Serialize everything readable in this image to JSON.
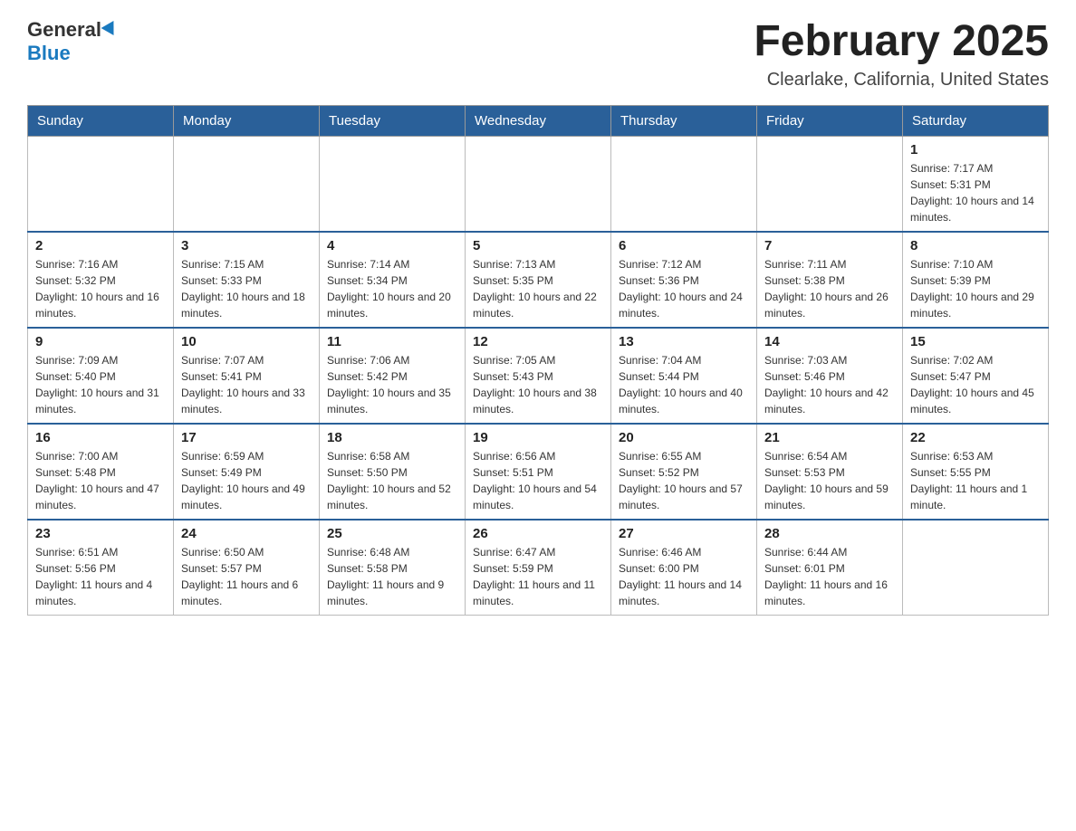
{
  "header": {
    "logo_general": "General",
    "logo_blue": "Blue",
    "title": "February 2025",
    "subtitle": "Clearlake, California, United States"
  },
  "days_of_week": [
    "Sunday",
    "Monday",
    "Tuesday",
    "Wednesday",
    "Thursday",
    "Friday",
    "Saturday"
  ],
  "weeks": [
    {
      "days": [
        {
          "number": "",
          "info": "",
          "empty": true
        },
        {
          "number": "",
          "info": "",
          "empty": true
        },
        {
          "number": "",
          "info": "",
          "empty": true
        },
        {
          "number": "",
          "info": "",
          "empty": true
        },
        {
          "number": "",
          "info": "",
          "empty": true
        },
        {
          "number": "",
          "info": "",
          "empty": true
        },
        {
          "number": "1",
          "info": "Sunrise: 7:17 AM\nSunset: 5:31 PM\nDaylight: 10 hours and 14 minutes.",
          "empty": false
        }
      ]
    },
    {
      "days": [
        {
          "number": "2",
          "info": "Sunrise: 7:16 AM\nSunset: 5:32 PM\nDaylight: 10 hours and 16 minutes.",
          "empty": false
        },
        {
          "number": "3",
          "info": "Sunrise: 7:15 AM\nSunset: 5:33 PM\nDaylight: 10 hours and 18 minutes.",
          "empty": false
        },
        {
          "number": "4",
          "info": "Sunrise: 7:14 AM\nSunset: 5:34 PM\nDaylight: 10 hours and 20 minutes.",
          "empty": false
        },
        {
          "number": "5",
          "info": "Sunrise: 7:13 AM\nSunset: 5:35 PM\nDaylight: 10 hours and 22 minutes.",
          "empty": false
        },
        {
          "number": "6",
          "info": "Sunrise: 7:12 AM\nSunset: 5:36 PM\nDaylight: 10 hours and 24 minutes.",
          "empty": false
        },
        {
          "number": "7",
          "info": "Sunrise: 7:11 AM\nSunset: 5:38 PM\nDaylight: 10 hours and 26 minutes.",
          "empty": false
        },
        {
          "number": "8",
          "info": "Sunrise: 7:10 AM\nSunset: 5:39 PM\nDaylight: 10 hours and 29 minutes.",
          "empty": false
        }
      ]
    },
    {
      "days": [
        {
          "number": "9",
          "info": "Sunrise: 7:09 AM\nSunset: 5:40 PM\nDaylight: 10 hours and 31 minutes.",
          "empty": false
        },
        {
          "number": "10",
          "info": "Sunrise: 7:07 AM\nSunset: 5:41 PM\nDaylight: 10 hours and 33 minutes.",
          "empty": false
        },
        {
          "number": "11",
          "info": "Sunrise: 7:06 AM\nSunset: 5:42 PM\nDaylight: 10 hours and 35 minutes.",
          "empty": false
        },
        {
          "number": "12",
          "info": "Sunrise: 7:05 AM\nSunset: 5:43 PM\nDaylight: 10 hours and 38 minutes.",
          "empty": false
        },
        {
          "number": "13",
          "info": "Sunrise: 7:04 AM\nSunset: 5:44 PM\nDaylight: 10 hours and 40 minutes.",
          "empty": false
        },
        {
          "number": "14",
          "info": "Sunrise: 7:03 AM\nSunset: 5:46 PM\nDaylight: 10 hours and 42 minutes.",
          "empty": false
        },
        {
          "number": "15",
          "info": "Sunrise: 7:02 AM\nSunset: 5:47 PM\nDaylight: 10 hours and 45 minutes.",
          "empty": false
        }
      ]
    },
    {
      "days": [
        {
          "number": "16",
          "info": "Sunrise: 7:00 AM\nSunset: 5:48 PM\nDaylight: 10 hours and 47 minutes.",
          "empty": false
        },
        {
          "number": "17",
          "info": "Sunrise: 6:59 AM\nSunset: 5:49 PM\nDaylight: 10 hours and 49 minutes.",
          "empty": false
        },
        {
          "number": "18",
          "info": "Sunrise: 6:58 AM\nSunset: 5:50 PM\nDaylight: 10 hours and 52 minutes.",
          "empty": false
        },
        {
          "number": "19",
          "info": "Sunrise: 6:56 AM\nSunset: 5:51 PM\nDaylight: 10 hours and 54 minutes.",
          "empty": false
        },
        {
          "number": "20",
          "info": "Sunrise: 6:55 AM\nSunset: 5:52 PM\nDaylight: 10 hours and 57 minutes.",
          "empty": false
        },
        {
          "number": "21",
          "info": "Sunrise: 6:54 AM\nSunset: 5:53 PM\nDaylight: 10 hours and 59 minutes.",
          "empty": false
        },
        {
          "number": "22",
          "info": "Sunrise: 6:53 AM\nSunset: 5:55 PM\nDaylight: 11 hours and 1 minute.",
          "empty": false
        }
      ]
    },
    {
      "days": [
        {
          "number": "23",
          "info": "Sunrise: 6:51 AM\nSunset: 5:56 PM\nDaylight: 11 hours and 4 minutes.",
          "empty": false
        },
        {
          "number": "24",
          "info": "Sunrise: 6:50 AM\nSunset: 5:57 PM\nDaylight: 11 hours and 6 minutes.",
          "empty": false
        },
        {
          "number": "25",
          "info": "Sunrise: 6:48 AM\nSunset: 5:58 PM\nDaylight: 11 hours and 9 minutes.",
          "empty": false
        },
        {
          "number": "26",
          "info": "Sunrise: 6:47 AM\nSunset: 5:59 PM\nDaylight: 11 hours and 11 minutes.",
          "empty": false
        },
        {
          "number": "27",
          "info": "Sunrise: 6:46 AM\nSunset: 6:00 PM\nDaylight: 11 hours and 14 minutes.",
          "empty": false
        },
        {
          "number": "28",
          "info": "Sunrise: 6:44 AM\nSunset: 6:01 PM\nDaylight: 11 hours and 16 minutes.",
          "empty": false
        },
        {
          "number": "",
          "info": "",
          "empty": true
        }
      ]
    }
  ]
}
